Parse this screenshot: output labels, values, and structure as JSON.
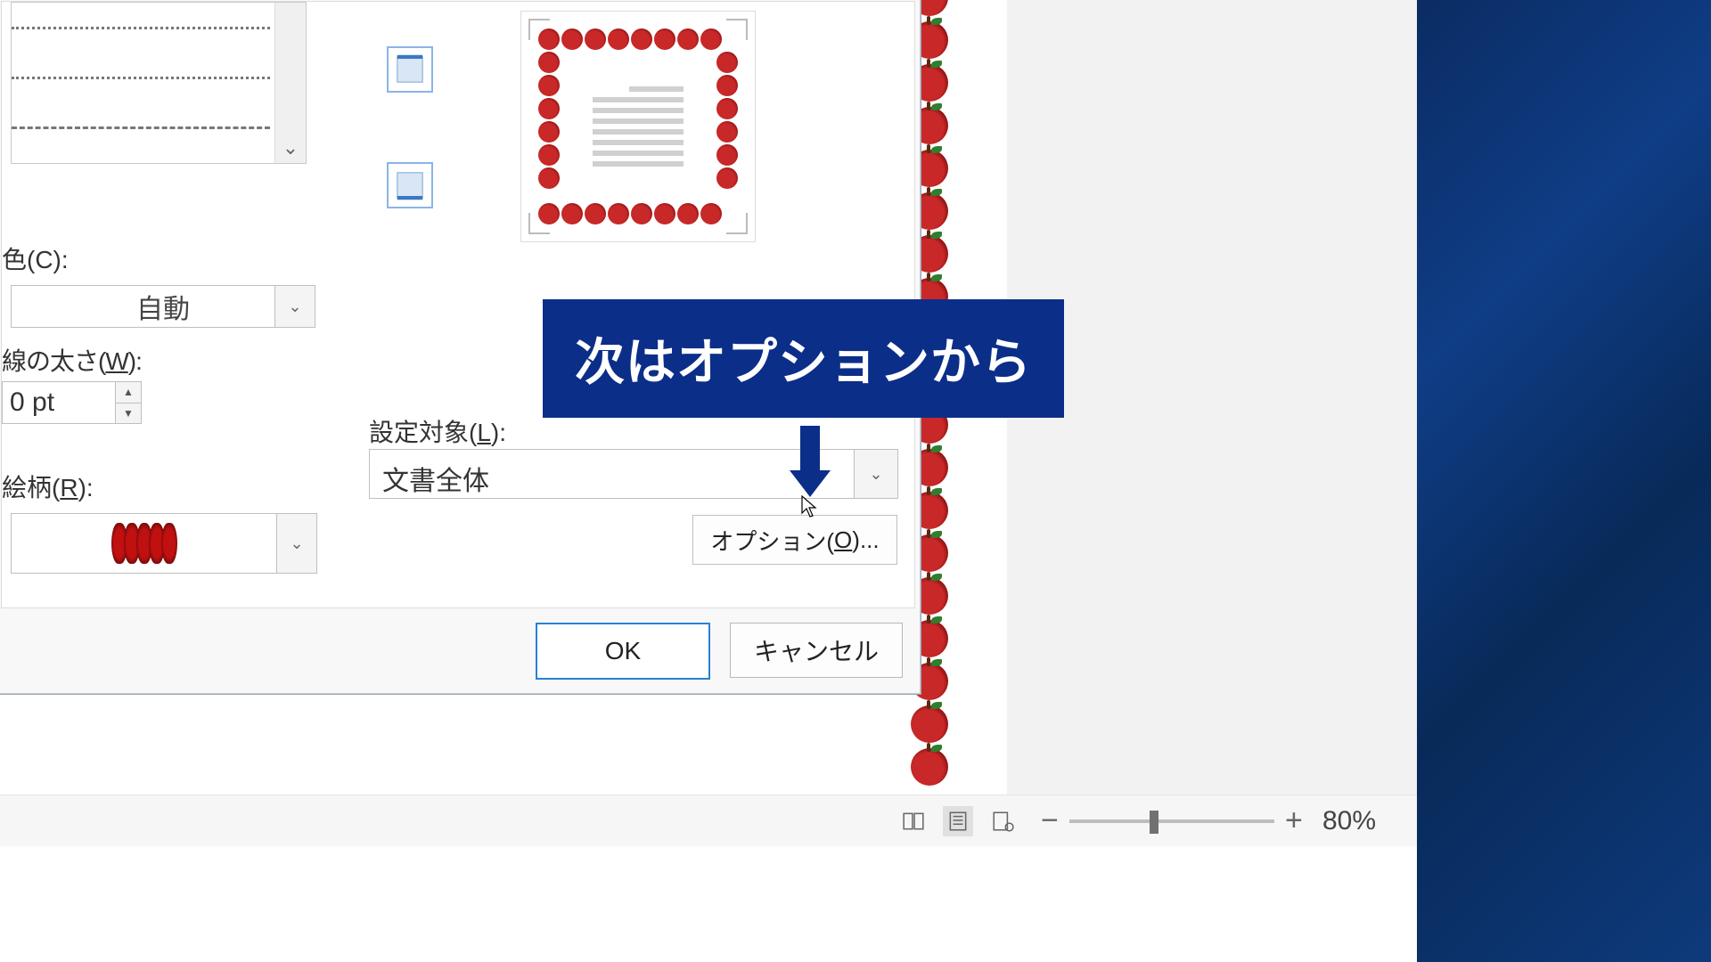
{
  "dialog": {
    "color_label_partial": "色(C):",
    "color_value": "自動",
    "width_label_partial": "線の太さ(W):",
    "width_value": "0 pt",
    "art_label_partial": "絵柄(R):",
    "apply_label_prefix": "設定対象(",
    "apply_label_mnemonic": "L",
    "apply_label_suffix": "):",
    "apply_value": "文書全体",
    "options_prefix": "オプション(",
    "options_mnemonic": "O",
    "options_suffix": ")...",
    "ok": "OK",
    "cancel": "キャンセル"
  },
  "callout": {
    "text": "次はオプションから"
  },
  "status": {
    "zoom": "80%"
  }
}
